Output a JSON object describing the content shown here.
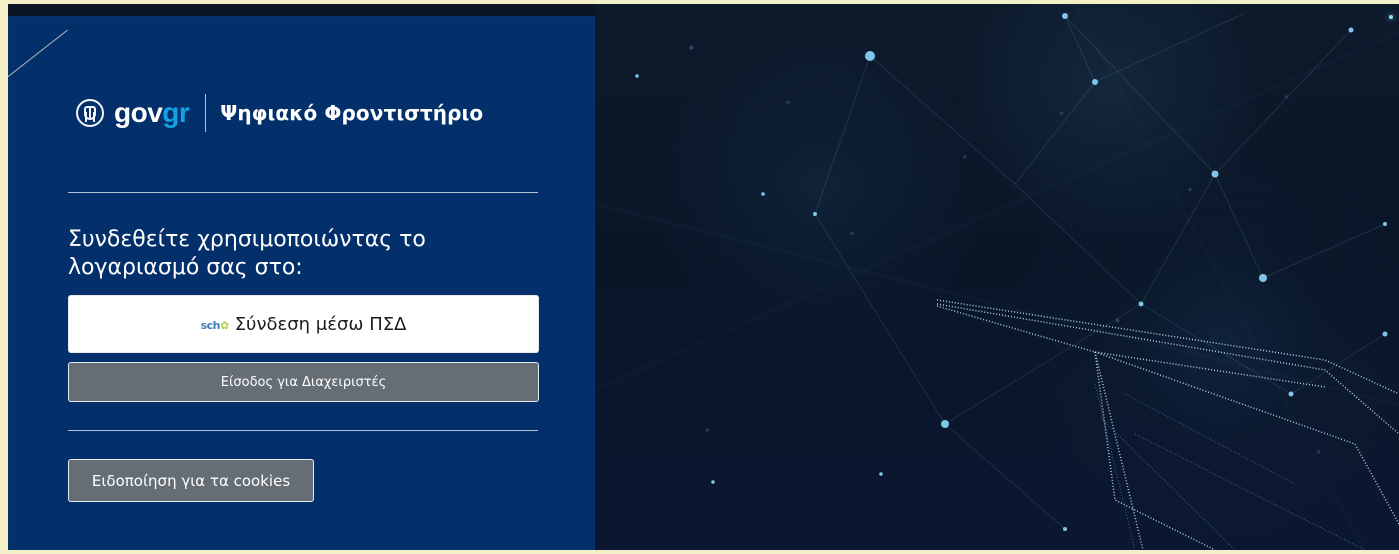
{
  "brand": {
    "gov": "gov",
    "gr": "gr",
    "title": "Ψηφιακό Φροντιστήριο"
  },
  "login": {
    "prompt": "Συνδεθείτε χρησιμοποιώντας το λογαριασμό σας στο:",
    "psd_logo": "sch",
    "psd_button": "Σύνδεση μέσω ΠΣΔ",
    "admin_button": "Είσοδος για Διαχειριστές",
    "cookies_button": "Ειδοποίηση για τα cookies"
  },
  "colors": {
    "left_panel": "#03306b",
    "gov_blue": "#14a0e6",
    "button_gray": "#656e75",
    "right_background": "#0a1628"
  },
  "icons": {
    "brand_emblem": "greek-emblem-icon",
    "sch_logo": "sch-logo-icon"
  }
}
